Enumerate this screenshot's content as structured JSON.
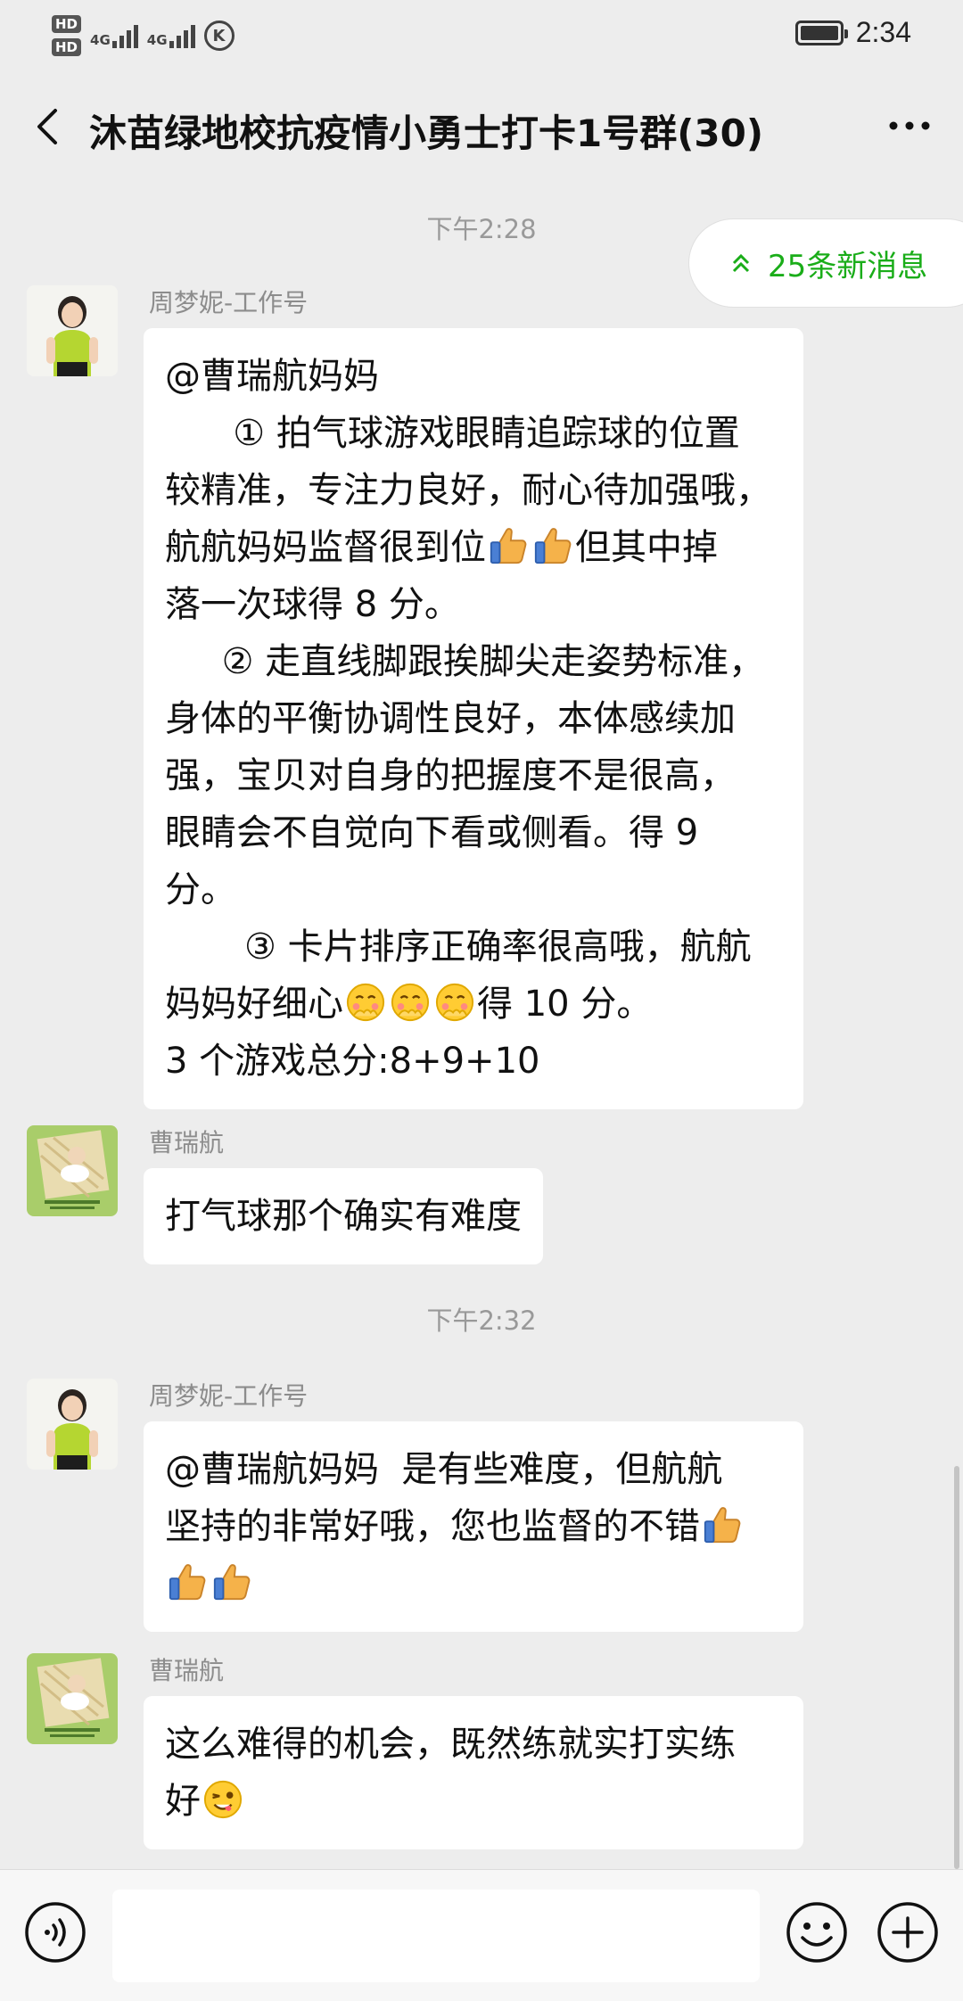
{
  "status_bar": {
    "hd1": "HD",
    "hd2": "HD",
    "net1": "4G",
    "net2": "4G",
    "k_badge": "K",
    "time": "2:34"
  },
  "header": {
    "title": "沐苗绿地校抗疫情小勇士打卡1号群(30)"
  },
  "new_messages": {
    "label": "25条新消息"
  },
  "messages": [
    {
      "type": "time",
      "text": "下午2:28"
    },
    {
      "type": "msg",
      "sender": "周梦妮-工作号",
      "lines": [
        "@曹瑞航妈妈",
        "      ① 拍气球游戏眼睛追踪球的位置",
        "较精准，专注力良好，耐心待加强哦，",
        "航航妈妈监督很到位",
        "但其中掉",
        "落一次球得 8 分。",
        "     ② 走直线脚跟挨脚尖走姿势标准，",
        "身体的平衡协调性良好，本体感续加",
        "强，宝贝对自身的把握度不是很高，",
        "眼睛会不自觉向下看或侧看。得 9",
        "分。",
        "       ③ 卡片排序正确率很高哦，航航",
        "妈妈好细心",
        "得 10 分。",
        "3 个游戏总分:8+9+10"
      ]
    },
    {
      "type": "msg",
      "sender": "曹瑞航",
      "text": "打气球那个确实有难度"
    },
    {
      "type": "time",
      "text": "下午2:32"
    },
    {
      "type": "msg",
      "sender": "周梦妮-工作号",
      "lines": [
        "@曹瑞航妈妈  是有些难度，但航航",
        "坚持的非常好哦，您也监督的不错"
      ]
    },
    {
      "type": "msg",
      "sender": "曹瑞航",
      "lines": [
        "这么难得的机会，既然练就实打实练",
        "好"
      ]
    }
  ],
  "icons": {
    "thumbs_up": "thumbs-up-emoji",
    "shy": "shy-emoji",
    "wink": "wink-tongue-emoji"
  },
  "colors": {
    "accent_green": "#1aad19",
    "chat_bg": "#ededed",
    "bubble_bg": "#ffffff"
  }
}
